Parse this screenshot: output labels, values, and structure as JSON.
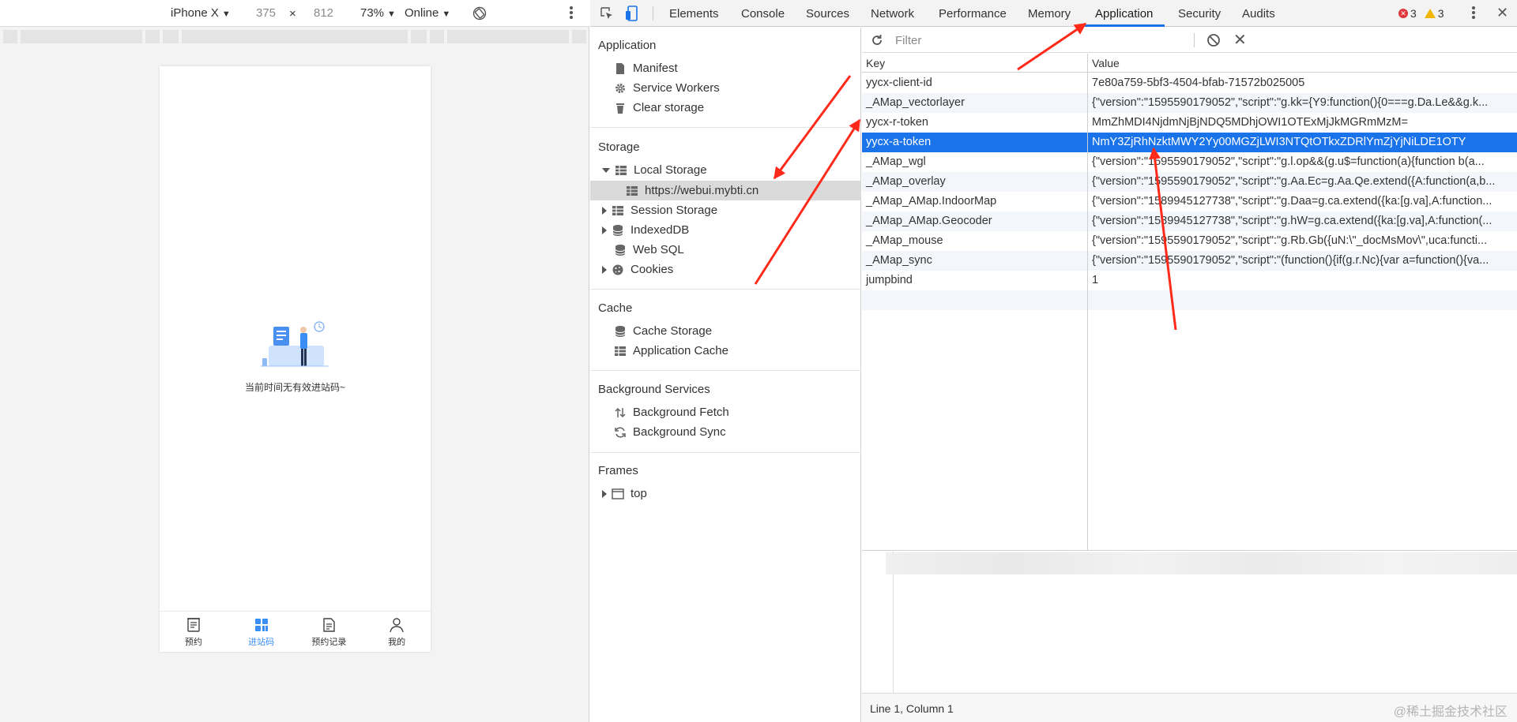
{
  "device_toolbar": {
    "device": "iPhone X",
    "width": "375",
    "times": "×",
    "height": "812",
    "zoom": "73%",
    "throttle": "Online"
  },
  "phone": {
    "empty_text": "当前时间无有效进站码~",
    "tabs": [
      {
        "label": "预约"
      },
      {
        "label": "进站码"
      },
      {
        "label": "预约记录"
      },
      {
        "label": "我的"
      }
    ],
    "active_color": "#3a8ef6"
  },
  "devtools": {
    "tabs": [
      "Elements",
      "Console",
      "Sources",
      "Network",
      "Performance",
      "Memory",
      "Application",
      "Security",
      "Audits"
    ],
    "active_tab": "Application",
    "error_count": "3",
    "warning_count": "3"
  },
  "sidebar": {
    "application": {
      "title": "Application",
      "items": [
        "Manifest",
        "Service Workers",
        "Clear storage"
      ]
    },
    "storage": {
      "title": "Storage",
      "local_storage": "Local Storage",
      "origin": "https://webui.mybti.cn",
      "items": [
        "Session Storage",
        "IndexedDB",
        "Web SQL",
        "Cookies"
      ]
    },
    "cache": {
      "title": "Cache",
      "items": [
        "Cache Storage",
        "Application Cache"
      ]
    },
    "background": {
      "title": "Background Services",
      "items": [
        "Background Fetch",
        "Background Sync"
      ]
    },
    "frames": {
      "title": "Frames",
      "items": [
        "top"
      ]
    }
  },
  "storage_table": {
    "filter_placeholder": "Filter",
    "headers": [
      "Key",
      "Value"
    ],
    "rows": [
      {
        "key": "yycx-client-id",
        "value": "7e80a759-5bf3-4504-bfab-71572b025005"
      },
      {
        "key": "_AMap_vectorlayer",
        "value": "{\"version\":\"1595590179052\",\"script\":\"g.kk={Y9:function(){0===g.Da.Le&&g.k..."
      },
      {
        "key": "yycx-r-token",
        "value": "MmZhMDI4NjdmNjBjNDQ5MDhjOWI1OTExMjJkMGRmMzM="
      },
      {
        "key": "yycx-a-token",
        "value": "NmY3ZjRhNzktMWY2Yy00MGZjLWI3NTQtOTkxZDRlYmZjYjNiLDE1OTY"
      },
      {
        "key": "_AMap_wgl",
        "value": "{\"version\":\"1595590179052\",\"script\":\"g.l.op&&(g.u$=function(a){function b(a..."
      },
      {
        "key": "_AMap_overlay",
        "value": "{\"version\":\"1595590179052\",\"script\":\"g.Aa.Ec=g.Aa.Qe.extend({A:function(a,b..."
      },
      {
        "key": "_AMap_AMap.IndoorMap",
        "value": "{\"version\":\"1589945127738\",\"script\":\"g.Daa=g.ca.extend({ka:[g.va],A:function..."
      },
      {
        "key": "_AMap_AMap.Geocoder",
        "value": "{\"version\":\"1589945127738\",\"script\":\"g.hW=g.ca.extend({ka:[g.va],A:function(..."
      },
      {
        "key": "_AMap_mouse",
        "value": "{\"version\":\"1595590179052\",\"script\":\"g.Rb.Gb({uN:\\\"_docMsMov\\\",uca:functi..."
      },
      {
        "key": "_AMap_sync",
        "value": "{\"version\":\"1595590179052\",\"script\":\"(function(){if(g.r.Nc){var a=function(){va..."
      },
      {
        "key": "jumpbind",
        "value": "1"
      }
    ],
    "selected_key": "yycx-a-token"
  },
  "status": {
    "position": "Line 1, Column 1",
    "watermark": "@稀土掘金技术社区"
  },
  "colors": {
    "selection": "#1a73e8",
    "arrow": "#ff2a1a"
  }
}
